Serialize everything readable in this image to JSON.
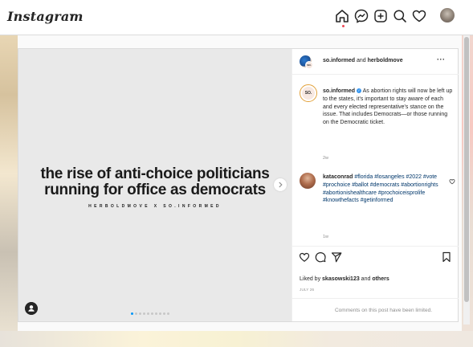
{
  "app": {
    "logo_text": "Instagram"
  },
  "nav": {
    "icons": [
      "home-icon",
      "messenger-icon",
      "new-post-icon",
      "explore-icon",
      "activity-heart-icon"
    ],
    "home_active_color": "#ed4956"
  },
  "post": {
    "media": {
      "headline_line1": "the rise of anti-choice politicians",
      "headline_line2": "running for office as democrats",
      "subline": "HERBOLDMOVE X SO.INFORMED",
      "carousel_count": 10,
      "carousel_active_index": 0,
      "avatar_badge": "SO."
    },
    "header": {
      "author1": "so.informed",
      "joiner": " and ",
      "author2": "herboldmove",
      "more": "···"
    },
    "caption": {
      "username": "so.informed",
      "text": " As abortion rights will now be left up to the states, it's important to stay aware of each and every elected representative's stance on the issue. That includes Democrats—or those running on the Democratic ticket.",
      "age": "2w"
    },
    "comment": {
      "username": "kataconrad",
      "text": "#florida #losangeles #2022 #vote #prochoice #ballot #democrats #abortionrights #abortionishealthcare #prochoiceisprolife #knowthefacts #getinformed",
      "age": "1w"
    },
    "likes": {
      "prefix": "Liked by ",
      "user": "skasowski123",
      "middle": " and ",
      "others": "others"
    },
    "date": "JULY 26",
    "comments_limited": "Comments on this post have been limited."
  },
  "colors": {
    "link": "#00376b",
    "verified": "#3897f0",
    "carousel_active": "#0095f6"
  }
}
